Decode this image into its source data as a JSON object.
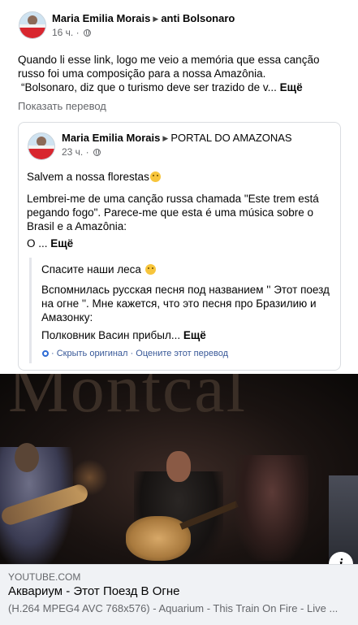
{
  "post": {
    "author": "Maria Emilia Morais",
    "group": "anti Bolsonaro",
    "time": "16 ч.",
    "dot": "·",
    "lines": [
      "Quando li esse link, logo me veio a memória que essa canção",
      "russo foi uma composição para a nossa Amazônia.",
      "“Bolsonaro, diz que o turismo deve ser trazido de v..."
    ],
    "more": "Ещё",
    "see_translation": "Показать перевод"
  },
  "shared": {
    "author": "Maria Emilia Morais",
    "group": "PORTAL DO AMAZONAS",
    "time": "23 ч.",
    "dot": "·",
    "line1": "Salvem a nossa florestas",
    "para": [
      "Lembrei-me de uma canção russa chamada \"Este trem está",
      "pegando fogo\". Parece-me que esta é uma música sobre o",
      "Brasil e a Amazônia:"
    ],
    "o_line": "O ...",
    "more": "Ещё",
    "translation": {
      "line1": "Спасите наши леса",
      "para": [
        "Вспомнилась русская песня под названием '' Этот поезд",
        "на огне ''. Мне кажется, что это песня про Бразилию и",
        "Амазонку:"
      ],
      "last": "Полковник Васин прибыл...",
      "more": "Ещё"
    },
    "hide_original": "· Скрыть оригинал",
    "rate_translation": "· Оцените этот перевод"
  },
  "video": {
    "bg_text": "Montcal",
    "info_icon": "info-icon"
  },
  "link": {
    "domain": "YOUTUBE.COM",
    "title": "Аквариум - Этот Поезд В Огне",
    "description": "(H.264 MPEG4 AVC 768x576) - Aquarium - This Train On Fire - Live ..."
  }
}
